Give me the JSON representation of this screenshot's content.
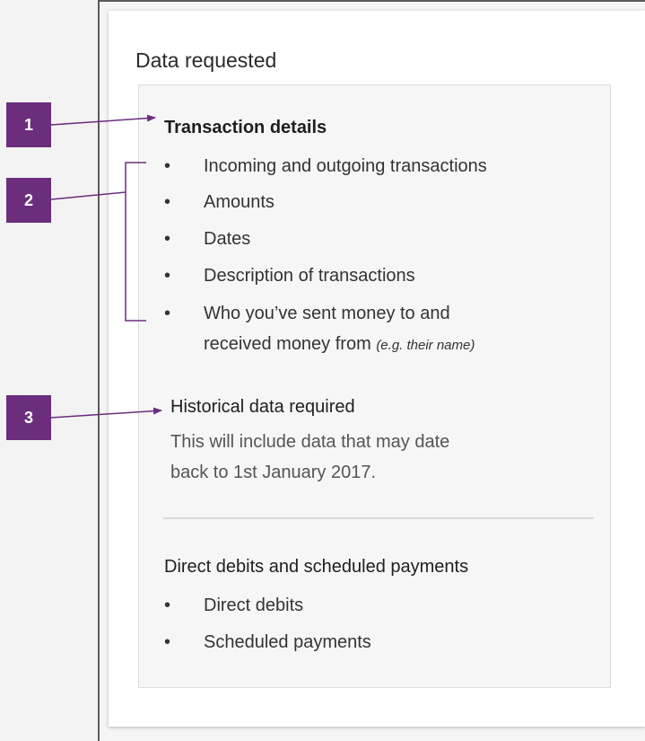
{
  "card": {
    "title": "Data requested"
  },
  "transaction_details": {
    "title": "Transaction details",
    "items": [
      "Incoming and outgoing transactions",
      "Amounts",
      "Dates",
      "Description of transactions",
      "Who you’ve sent money to and"
    ],
    "item5_line2": "received money from",
    "item5_note": "(e.g. their name)"
  },
  "historical": {
    "title": "Historical data required",
    "line1": "This will include data that may date",
    "line2": "back to 1st January 2017."
  },
  "direct_debits": {
    "title": "Direct debits and scheduled payments",
    "items": [
      "Direct debits",
      "Scheduled payments"
    ]
  },
  "callouts": {
    "badge1": "1",
    "badge2": "2",
    "badge3": "3",
    "color": "#6b2d7c"
  },
  "bullet_glyph": "•"
}
